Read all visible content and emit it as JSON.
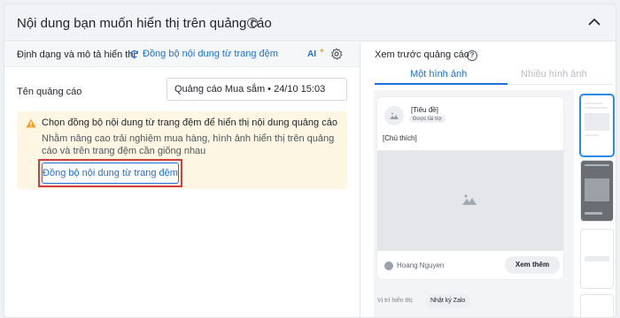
{
  "header": {
    "title": "Nội dung bạn muốn hiển thị trên quảng cáo"
  },
  "left": {
    "section_label": "Định dạng và mô tả hiển thị",
    "sync_link": "Đồng bộ nội dung từ trang đệm",
    "ai_label": "AI",
    "name_label": "Tên quảng cáo",
    "name_value": "Quảng cáo Mua sắm • 24/10 15:03",
    "warning": {
      "title": "Chọn đồng bộ nội dung từ trang đệm để hiển thị nội dung quảng cáo",
      "body": "Nhằm nâng cao trải nghiệm mua hàng, hình ảnh hiển thị trên quảng cáo và trên trang đệm cần giống nhau",
      "button": "Đồng bộ nội dung từ trang đệm"
    }
  },
  "right": {
    "title": "Xem trước quảng cáo",
    "tabs": [
      {
        "label": "Một hình ảnh",
        "active": true
      },
      {
        "label": "Nhiều hình ảnh",
        "active": false
      }
    ],
    "card": {
      "title": "[Tiêu đề]",
      "sponsored": "Được tài trợ",
      "caption": "[Chú thích]",
      "user": "Hoang Nguyen",
      "cta": "Xem thêm"
    },
    "placement_label": "Vị trí hiển thị:",
    "placement_value": "Nhật ký Zalo"
  },
  "colors": {
    "accent": "#1e6fd9",
    "highlight": "#d93b3b",
    "warning_bg": "#fdf6e3"
  }
}
